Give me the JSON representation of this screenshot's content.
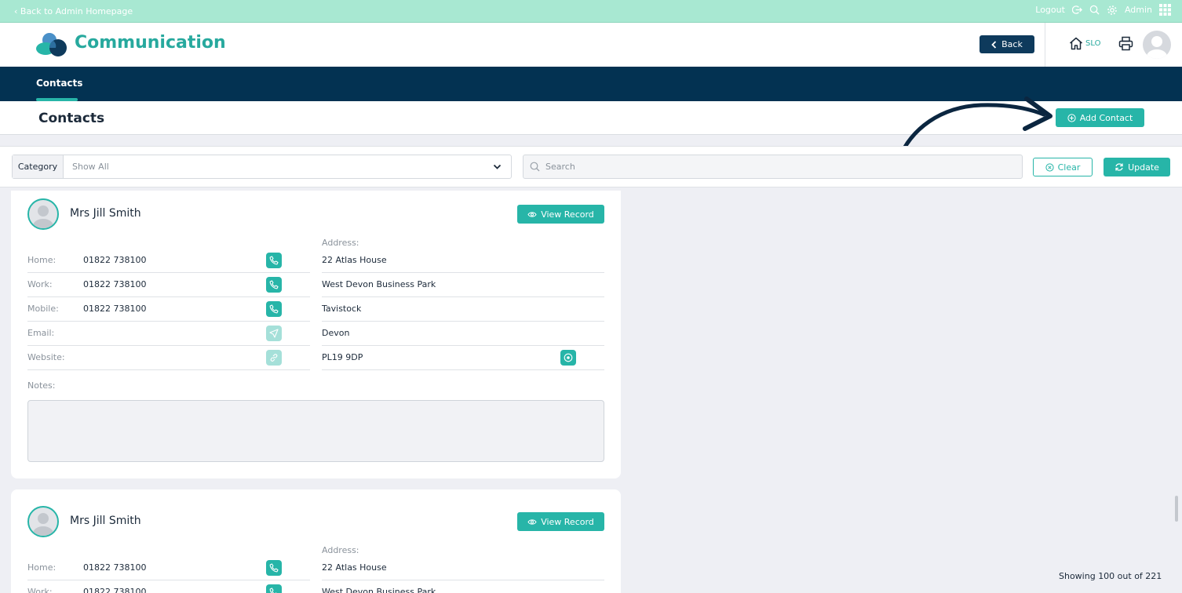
{
  "topbar": {
    "back_link": "‹ Back to Admin Homepage",
    "logout": "Logout",
    "user": "Admin",
    "icons": [
      "logout-icon",
      "search-icon",
      "gear-icon",
      "apps-grid-icon"
    ]
  },
  "header": {
    "app_title": "Communication",
    "back_button": "Back",
    "site_code": "SLO"
  },
  "nav": {
    "tabs": [
      {
        "label": "Contacts",
        "active": true
      }
    ]
  },
  "page": {
    "title": "Contacts",
    "add_button": "Add Contact"
  },
  "filters": {
    "category_label": "Category",
    "category_value": "Show All",
    "search_placeholder": "Search",
    "clear_button": "Clear",
    "update_button": "Update"
  },
  "contacts": [
    {
      "name": "Mrs Jill Smith",
      "view_button": "View Record",
      "address_label": "Address:",
      "fields": [
        {
          "label": "Home:",
          "value": "01822 738100"
        },
        {
          "label": "Work:",
          "value": "01822 738100"
        },
        {
          "label": "Mobile:",
          "value": "01822 738100"
        },
        {
          "label": "Email:",
          "value": ""
        },
        {
          "label": "Website:",
          "value": ""
        }
      ],
      "address_lines": [
        "22 Atlas House",
        "West Devon Business Park",
        "Tavistock",
        "Devon",
        "PL19 9DP"
      ],
      "notes_label": "Notes:",
      "notes": ""
    },
    {
      "name": "Mrs Jill Smith",
      "view_button": "View Record",
      "address_label": "Address:",
      "fields": [
        {
          "label": "Home:",
          "value": "01822 738100"
        },
        {
          "label": "Work:",
          "value": "01822 738100"
        }
      ],
      "address_lines": [
        "22 Atlas House",
        "West Devon Business Park"
      ]
    }
  ],
  "footer": {
    "showing": "Showing 100 out of 221"
  },
  "colors": {
    "accent": "#27b5a8",
    "navy": "#033252",
    "topbar": "#a8e8d2",
    "background": "#eeeff4"
  }
}
